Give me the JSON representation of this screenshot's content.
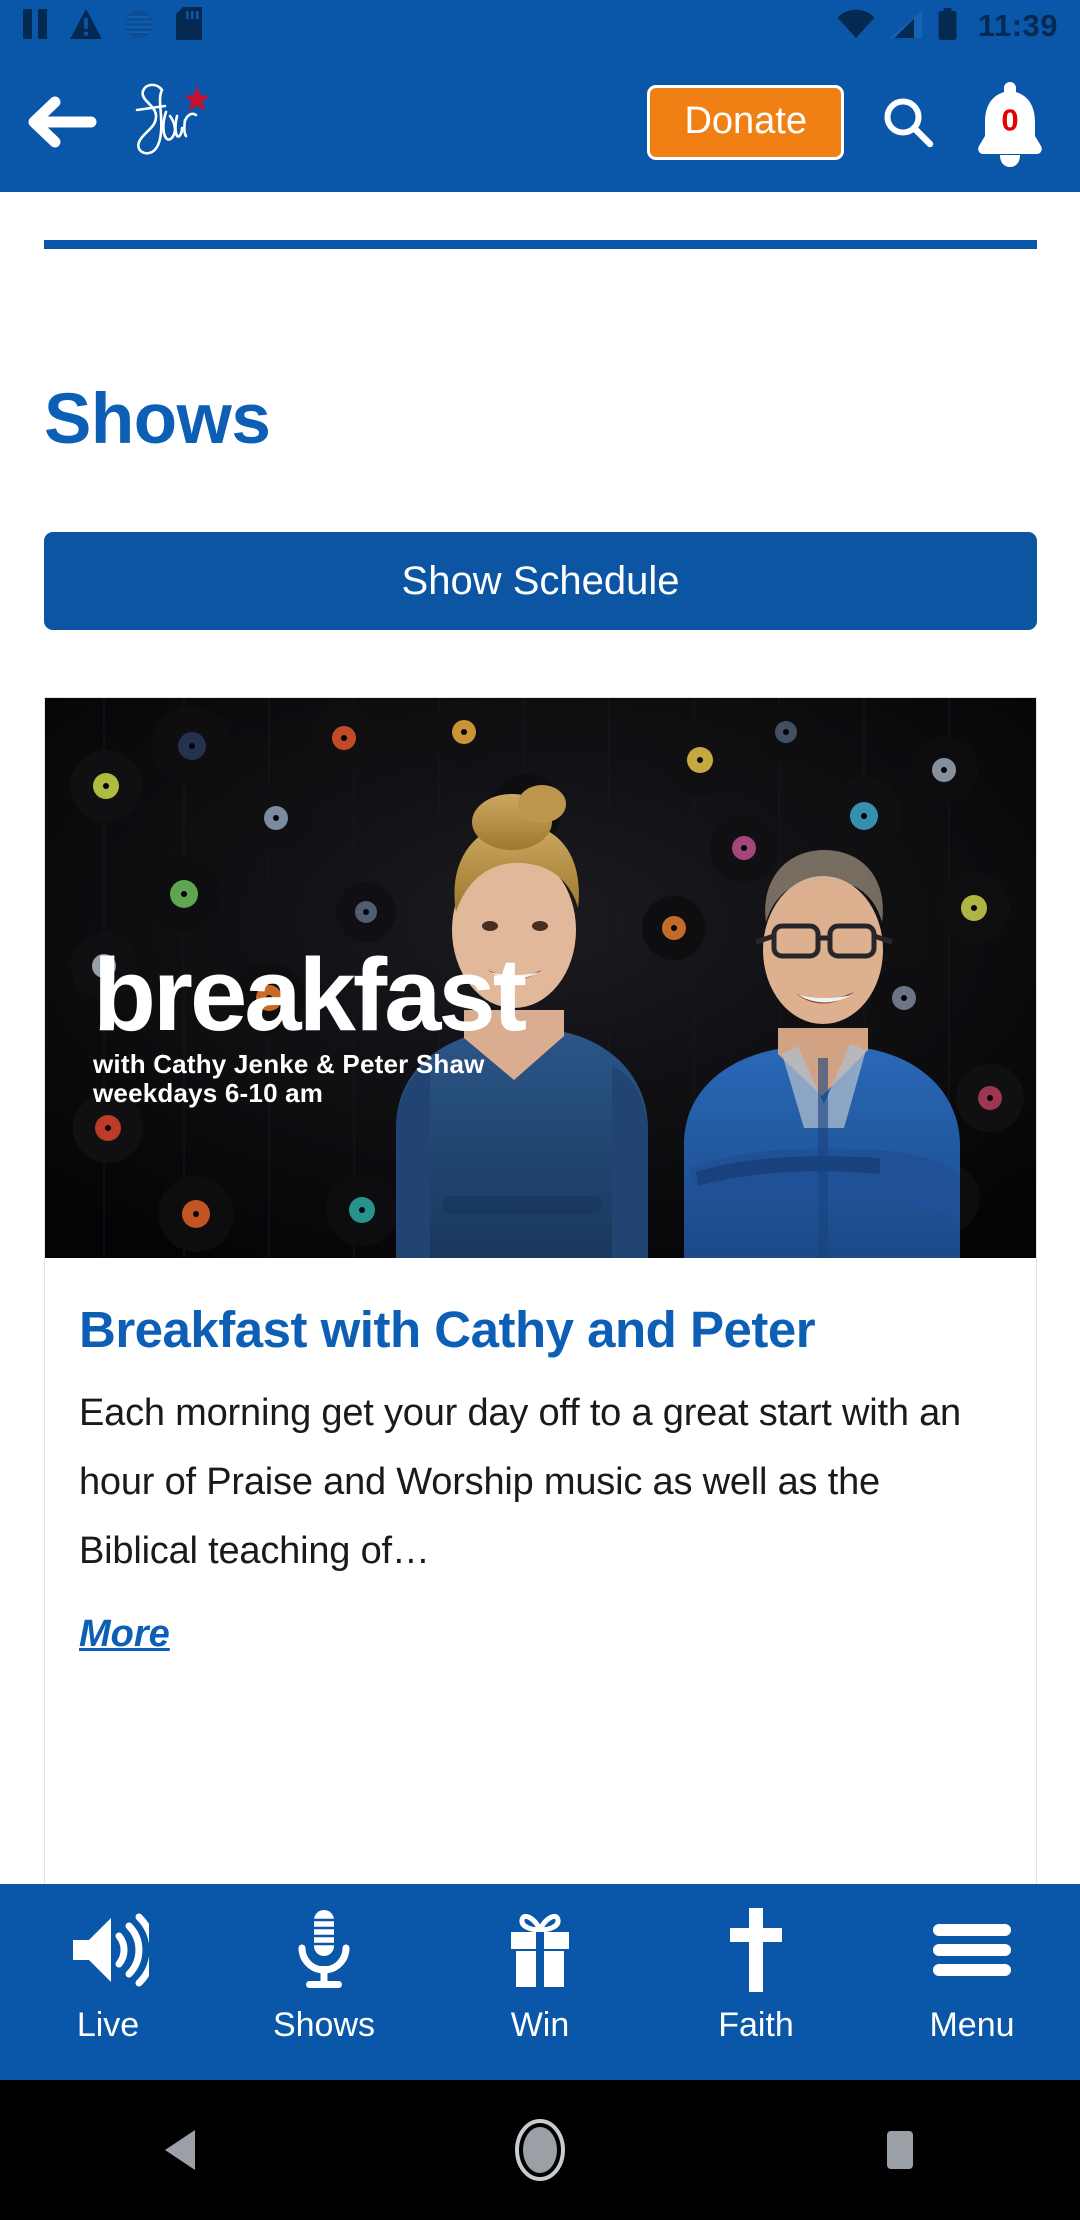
{
  "status_bar": {
    "time": "11:39",
    "left_icons": [
      "pause-icon",
      "warning-icon",
      "circle-dotted-icon",
      "sd-card-icon"
    ],
    "right_icons": [
      "wifi-icon",
      "cellular-signal-icon",
      "battery-icon"
    ],
    "background_color": "#0A56A8",
    "icon_color": "#052A52"
  },
  "app_bar": {
    "back_label": "Back",
    "brand_name": "Star",
    "donate_label": "Donate",
    "donate_color": "#F08013",
    "search_icon": "search-icon",
    "notification_icon": "bell-icon",
    "notification_count": "0",
    "notification_count_color": "#E60000"
  },
  "page": {
    "title": "Shows",
    "title_color": "#0D5FB6",
    "schedule_button_label": "Show Schedule",
    "schedule_button_color": "#0B55A3"
  },
  "show_card": {
    "image_overlay": {
      "title": "breakfast",
      "subtitle_line1": "with Cathy Jenke & Peter Shaw",
      "subtitle_line2": "weekdays 6-10 am"
    },
    "title": "Breakfast with Cathy and Peter",
    "description": "Each morning get your day off to a great start with an hour of Praise and Worship music as well as the Biblical teaching of…",
    "more_label": "More",
    "link_color": "#0D5FB6"
  },
  "bottom_nav": {
    "items": [
      {
        "label": "Live",
        "icon": "speaker-volume-icon"
      },
      {
        "label": "Shows",
        "icon": "microphone-icon"
      },
      {
        "label": "Win",
        "icon": "gift-icon"
      },
      {
        "label": "Faith",
        "icon": "cross-icon"
      },
      {
        "label": "Menu",
        "icon": "hamburger-menu-icon"
      }
    ],
    "background_color": "#0A56A8"
  },
  "android_nav": {
    "back": "back-triangle-icon",
    "home": "home-circle-icon",
    "recents": "recents-square-icon",
    "icon_color": "#9AA0A6"
  }
}
